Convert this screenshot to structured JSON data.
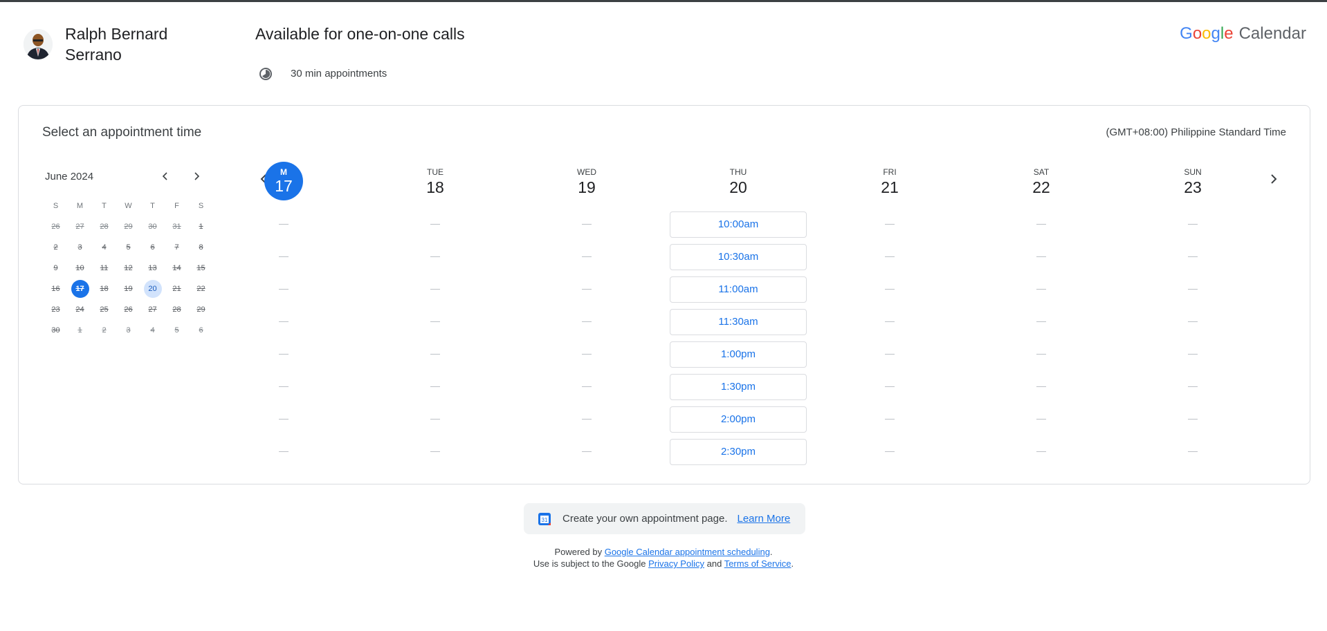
{
  "header": {
    "host_name": "Ralph Bernard Serrano",
    "page_title": "Available for one-on-one calls",
    "duration_text": "30 min appointments",
    "brand_google": [
      "G",
      "o",
      "o",
      "g",
      "l",
      "e"
    ],
    "brand_google_colors": [
      "#4285F4",
      "#EA4335",
      "#FBBC05",
      "#4285F4",
      "#34A853",
      "#EA4335"
    ],
    "brand_calendar": "Calendar"
  },
  "card": {
    "title": "Select an appointment time",
    "timezone": "(GMT+08:00) Philippine Standard Time"
  },
  "mini_calendar": {
    "month_label": "June 2024",
    "weekdays": [
      "S",
      "M",
      "T",
      "W",
      "T",
      "F",
      "S"
    ],
    "weeks": [
      [
        {
          "d": "26",
          "s": "dis muted"
        },
        {
          "d": "27",
          "s": "dis muted"
        },
        {
          "d": "28",
          "s": "dis muted"
        },
        {
          "d": "29",
          "s": "dis muted"
        },
        {
          "d": "30",
          "s": "dis muted"
        },
        {
          "d": "31",
          "s": "dis muted"
        },
        {
          "d": "1",
          "s": "dis"
        }
      ],
      [
        {
          "d": "2",
          "s": "dis"
        },
        {
          "d": "3",
          "s": "dis"
        },
        {
          "d": "4",
          "s": "dis"
        },
        {
          "d": "5",
          "s": "dis"
        },
        {
          "d": "6",
          "s": "dis"
        },
        {
          "d": "7",
          "s": "dis"
        },
        {
          "d": "8",
          "s": "dis"
        }
      ],
      [
        {
          "d": "9",
          "s": "dis"
        },
        {
          "d": "10",
          "s": "dis"
        },
        {
          "d": "11",
          "s": "dis"
        },
        {
          "d": "12",
          "s": "dis"
        },
        {
          "d": "13",
          "s": "dis"
        },
        {
          "d": "14",
          "s": "dis"
        },
        {
          "d": "15",
          "s": "dis"
        }
      ],
      [
        {
          "d": "16",
          "s": "dis"
        },
        {
          "d": "17",
          "s": "sel dis"
        },
        {
          "d": "18",
          "s": "dis"
        },
        {
          "d": "19",
          "s": "dis"
        },
        {
          "d": "20",
          "s": "avail"
        },
        {
          "d": "21",
          "s": "dis"
        },
        {
          "d": "22",
          "s": "dis"
        }
      ],
      [
        {
          "d": "23",
          "s": "dis"
        },
        {
          "d": "24",
          "s": "dis"
        },
        {
          "d": "25",
          "s": "dis"
        },
        {
          "d": "26",
          "s": "dis"
        },
        {
          "d": "27",
          "s": "dis"
        },
        {
          "d": "28",
          "s": "dis"
        },
        {
          "d": "29",
          "s": "dis"
        }
      ],
      [
        {
          "d": "30",
          "s": "dis"
        },
        {
          "d": "1",
          "s": "dis muted"
        },
        {
          "d": "2",
          "s": "dis muted"
        },
        {
          "d": "3",
          "s": "dis muted"
        },
        {
          "d": "4",
          "s": "dis muted"
        },
        {
          "d": "5",
          "s": "dis muted"
        },
        {
          "d": "6",
          "s": "dis muted"
        }
      ]
    ]
  },
  "week": {
    "days": [
      {
        "dow": "M",
        "num": "17",
        "today": true,
        "slots": []
      },
      {
        "dow": "TUE",
        "num": "18",
        "slots": []
      },
      {
        "dow": "WED",
        "num": "19",
        "slots": []
      },
      {
        "dow": "THU",
        "num": "20",
        "slots": [
          "10:00am",
          "10:30am",
          "11:00am",
          "11:30am",
          "1:00pm",
          "1:30pm",
          "2:00pm",
          "2:30pm"
        ]
      },
      {
        "dow": "FRI",
        "num": "21",
        "slots": []
      },
      {
        "dow": "SAT",
        "num": "22",
        "slots": []
      },
      {
        "dow": "SUN",
        "num": "23",
        "slots": []
      }
    ],
    "row_count": 8
  },
  "footer": {
    "promo_text": "Create your own appointment page.",
    "learn_more": "Learn More",
    "powered_prefix": "Powered by ",
    "powered_link": "Google Calendar appointment scheduling",
    "powered_suffix": ".",
    "terms_prefix": "Use is subject to the Google ",
    "privacy_link": "Privacy Policy",
    "and_text": " and ",
    "terms_link": "Terms of Service",
    "terms_suffix": "."
  },
  "colors": {
    "accent": "#1a73e8",
    "available_day": "#d2e3fc"
  }
}
